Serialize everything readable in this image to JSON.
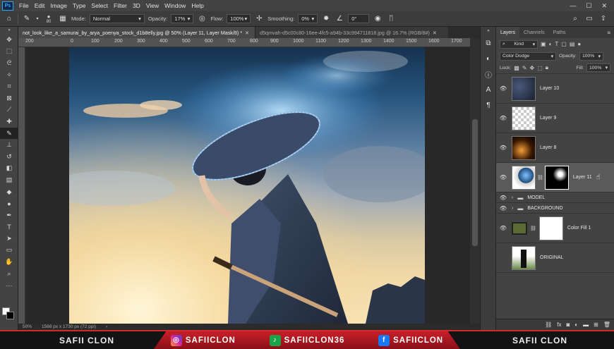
{
  "app": {
    "logo": "Ps"
  },
  "menu": [
    "File",
    "Edit",
    "Image",
    "Type",
    "Select",
    "Filter",
    "3D",
    "View",
    "Window",
    "Help"
  ],
  "window_controls": {
    "minimize": "—",
    "maximize": "☐",
    "close": "✕"
  },
  "options": {
    "brush_size": "80",
    "mode_label": "Mode:",
    "mode_value": "Normal",
    "opacity_label": "Opacity:",
    "opacity_value": "17%",
    "flow_label": "Flow:",
    "flow_value": "100%",
    "smoothing_label": "Smoothing:",
    "smoothing_value": "0%",
    "angle_value": "0°"
  },
  "doc_tabs": [
    {
      "label": "not_look_like_a_samurai_by_arya_poenya_stock_d1b8elly.jpg @ 50% (Layer 11, Layer Mask/8) *",
      "active": true
    },
    {
      "label": "d5qmvah-d5c00c80-16ee-4fc5-a94b-33c994711818.jpg @ 16.7% (RGB/8#)",
      "active": false
    }
  ],
  "ruler_marks": [
    "200",
    "0",
    "100",
    "200",
    "300",
    "400",
    "500",
    "600",
    "700",
    "800",
    "900",
    "1000",
    "1100",
    "1200",
    "1300",
    "1400",
    "1500",
    "1600",
    "1700"
  ],
  "status": {
    "zoom": "50%",
    "doc_size": "1568 px x 1730 px (72 ppi)"
  },
  "panel": {
    "tabs": [
      "Layers",
      "Channels",
      "Paths"
    ],
    "kind_label": "Kind",
    "blend_mode": "Color Dodge",
    "opacity_label": "Opacity:",
    "opacity_value": "100%",
    "lock_label": "Lock:",
    "fill_label": "Fill:",
    "fill_value": "100%",
    "layers": [
      {
        "name": "Layer 10",
        "type": "image",
        "visible": true,
        "selected": false
      },
      {
        "name": "Layer 9",
        "type": "transparent",
        "visible": true,
        "selected": false
      },
      {
        "name": "Layer 8",
        "type": "glow",
        "visible": true,
        "selected": false
      },
      {
        "name": "Layer 11",
        "type": "masked",
        "visible": true,
        "selected": true
      },
      {
        "name": "MODEL",
        "type": "group",
        "visible": true,
        "selected": false
      },
      {
        "name": "BACKGROUND",
        "type": "group",
        "visible": true,
        "selected": false
      },
      {
        "name": "Color Fill 1",
        "type": "fill",
        "visible": true,
        "selected": false
      },
      {
        "name": "ORIGINAL",
        "type": "original",
        "visible": false,
        "selected": false
      }
    ]
  },
  "banner": {
    "left": "SAFII CLON",
    "right": "SAFII CLON",
    "instagram": "SAFIICLON",
    "tiktok": "SAFIICLON36",
    "facebook": "SAFIICLON"
  },
  "colors": {
    "accent": "#31a8ff",
    "banner_red": "#c8202a",
    "panel_bg": "#434343"
  }
}
